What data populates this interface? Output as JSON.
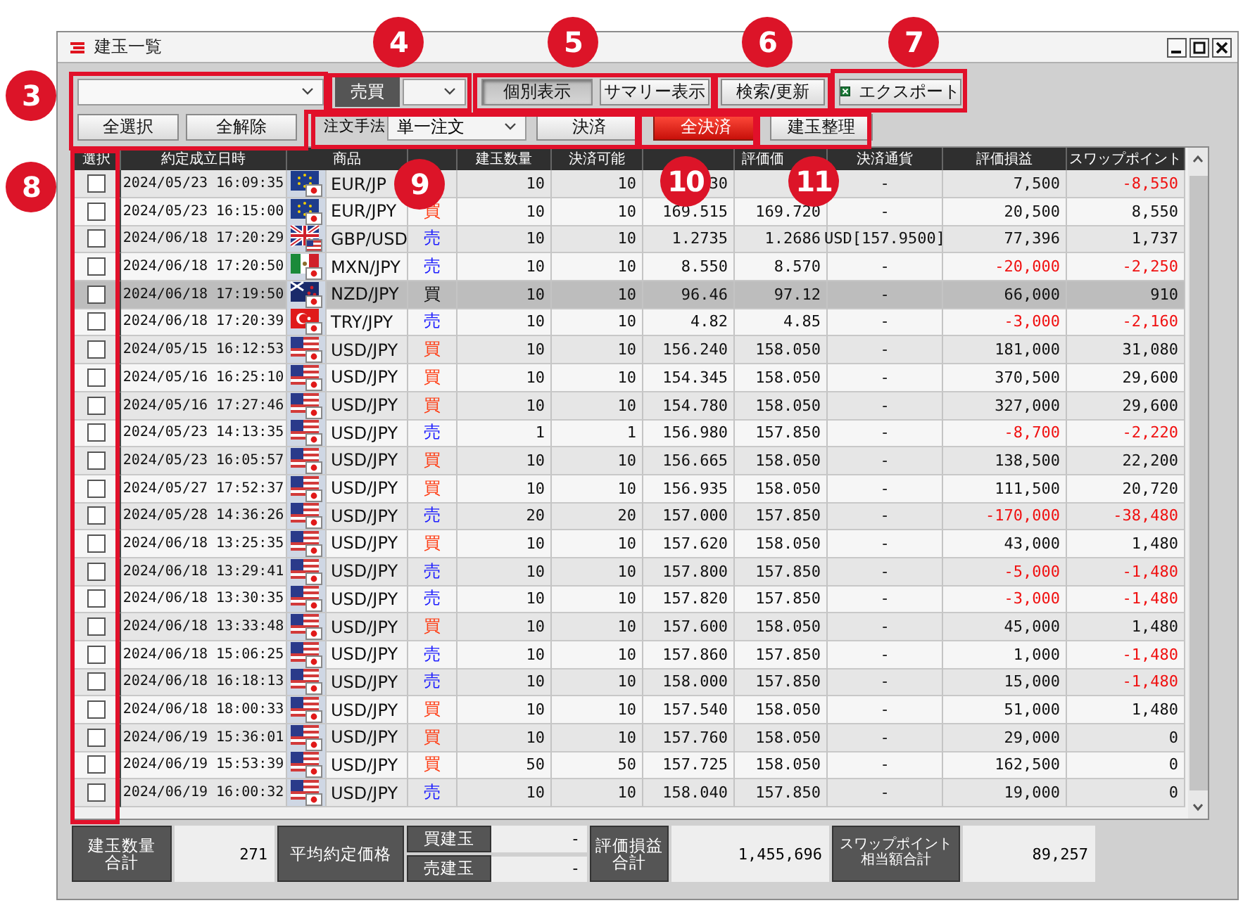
{
  "window": {
    "title": "建玉一覧"
  },
  "toolbar": {
    "side_label": "売買",
    "view_buttons": [
      {
        "label": "個別表示",
        "selected": true
      },
      {
        "label": "サマリー表示",
        "selected": false
      }
    ],
    "search_button": "検索/更新",
    "export_button": "エクスポート",
    "select_all_button": "全選択",
    "deselect_all_button": "全解除",
    "order_method_label": "注文手法",
    "order_method": "単一注文",
    "settle_button": "決済",
    "settle_all_button": "全決済",
    "organize_button": "建玉整理"
  },
  "table": {
    "columns": [
      "選択",
      "約定成立日時",
      "商品",
      null,
      "建玉数量",
      "決済可能",
      null,
      "評価価",
      "決済通貨",
      "評価損益",
      "スワップポイント"
    ],
    "rows": [
      {
        "checked": false,
        "selected": false,
        "datetime": "2024/05/23 16:09:35",
        "flag": {
          "kind": "eu"
        },
        "quote_flag": {
          "kind": "jp"
        },
        "pair": "EUR/JP",
        "qty": "10",
        "settleable": "10",
        "price": "30",
        "currency": "-",
        "pl": {
          "text": "7,500",
          "color": "#111111"
        },
        "swap": {
          "text": "-8,550",
          "color": "#f01010"
        }
      },
      {
        "checked": false,
        "selected": false,
        "datetime": "2024/05/23 16:15:00",
        "flag": {
          "kind": "eu"
        },
        "quote_flag": {
          "kind": "jp"
        },
        "pair": "EUR/JPY",
        "side": {
          "text": "買",
          "color": "#ff3a10"
        },
        "qty": "10",
        "settleable": "10",
        "price": "169.515",
        "eval_price": "169.720",
        "currency": "-",
        "pl": {
          "text": "20,500",
          "color": "#111111"
        },
        "swap": {
          "text": "8,550",
          "color": "#111111"
        }
      },
      {
        "checked": false,
        "selected": false,
        "datetime": "2024/06/18 17:20:29",
        "flag": {
          "kind": "gb"
        },
        "quote_flag": {
          "kind": "us"
        },
        "pair": "GBP/USD",
        "side": {
          "text": "売",
          "color": "#1a1aff"
        },
        "qty": "10",
        "settleable": "10",
        "price": "1.2735",
        "eval_price": "1.2686",
        "currency": "USD[157.9500]",
        "pl": {
          "text": "77,396",
          "color": "#111111"
        },
        "swap": {
          "text": "1,737",
          "color": "#111111"
        }
      },
      {
        "checked": false,
        "selected": false,
        "datetime": "2024/06/18 17:20:50",
        "flag": {
          "kind": "mx"
        },
        "quote_flag": {
          "kind": "jp"
        },
        "pair": "MXN/JPY",
        "side": {
          "text": "売",
          "color": "#1a1aff"
        },
        "qty": "10",
        "settleable": "10",
        "price": "8.550",
        "eval_price": "8.570",
        "currency": "-",
        "pl": {
          "text": "-20,000",
          "color": "#f01010"
        },
        "swap": {
          "text": "-2,250",
          "color": "#f01010"
        }
      },
      {
        "checked": false,
        "selected": true,
        "datetime": "2024/06/18 17:19:50",
        "flag": {
          "kind": "nz"
        },
        "quote_flag": {
          "kind": "jp"
        },
        "pair": "NZD/JPY",
        "side": {
          "text": "買",
          "color": "#111111"
        },
        "qty": "10",
        "settleable": "10",
        "price": "96.46",
        "eval_price": "97.12",
        "currency": "-",
        "pl": {
          "text": "66,000",
          "color": "#111111"
        },
        "swap": {
          "text": "910",
          "color": "#111111"
        }
      },
      {
        "checked": false,
        "selected": false,
        "datetime": "2024/06/18 17:20:39",
        "flag": {
          "kind": "tr"
        },
        "quote_flag": {
          "kind": "jp"
        },
        "pair": "TRY/JPY",
        "side": {
          "text": "売",
          "color": "#1a1aff"
        },
        "qty": "10",
        "settleable": "10",
        "price": "4.82",
        "eval_price": "4.85",
        "currency": "-",
        "pl": {
          "text": "-3,000",
          "color": "#f01010"
        },
        "swap": {
          "text": "-2,160",
          "color": "#f01010"
        }
      },
      {
        "checked": false,
        "selected": false,
        "datetime": "2024/05/15 16:12:53",
        "flag": {
          "kind": "us"
        },
        "quote_flag": {
          "kind": "jp"
        },
        "pair": "USD/JPY",
        "side": {
          "text": "買",
          "color": "#ff3a10"
        },
        "qty": "10",
        "settleable": "10",
        "price": "156.240",
        "eval_price": "158.050",
        "currency": "-",
        "pl": {
          "text": "181,000",
          "color": "#111111"
        },
        "swap": {
          "text": "31,080",
          "color": "#111111"
        }
      },
      {
        "checked": false,
        "selected": false,
        "datetime": "2024/05/16 16:25:10",
        "flag": {
          "kind": "us"
        },
        "quote_flag": {
          "kind": "jp"
        },
        "pair": "USD/JPY",
        "side": {
          "text": "買",
          "color": "#ff3a10"
        },
        "qty": "10",
        "settleable": "10",
        "price": "154.345",
        "eval_price": "158.050",
        "currency": "-",
        "pl": {
          "text": "370,500",
          "color": "#111111"
        },
        "swap": {
          "text": "29,600",
          "color": "#111111"
        }
      },
      {
        "checked": false,
        "selected": false,
        "datetime": "2024/05/16 17:27:46",
        "flag": {
          "kind": "us"
        },
        "quote_flag": {
          "kind": "jp"
        },
        "pair": "USD/JPY",
        "side": {
          "text": "買",
          "color": "#ff3a10"
        },
        "qty": "10",
        "settleable": "10",
        "price": "154.780",
        "eval_price": "158.050",
        "currency": "-",
        "pl": {
          "text": "327,000",
          "color": "#111111"
        },
        "swap": {
          "text": "29,600",
          "color": "#111111"
        }
      },
      {
        "checked": false,
        "selected": false,
        "datetime": "2024/05/23 14:13:35",
        "flag": {
          "kind": "us"
        },
        "quote_flag": {
          "kind": "jp"
        },
        "pair": "USD/JPY",
        "side": {
          "text": "売",
          "color": "#1a1aff"
        },
        "qty": "1",
        "settleable": "1",
        "price": "156.980",
        "eval_price": "157.850",
        "currency": "-",
        "pl": {
          "text": "-8,700",
          "color": "#f01010"
        },
        "swap": {
          "text": "-2,220",
          "color": "#f01010"
        }
      },
      {
        "checked": false,
        "selected": false,
        "datetime": "2024/05/23 16:05:57",
        "flag": {
          "kind": "us"
        },
        "quote_flag": {
          "kind": "jp"
        },
        "pair": "USD/JPY",
        "side": {
          "text": "買",
          "color": "#ff3a10"
        },
        "qty": "10",
        "settleable": "10",
        "price": "156.665",
        "eval_price": "158.050",
        "currency": "-",
        "pl": {
          "text": "138,500",
          "color": "#111111"
        },
        "swap": {
          "text": "22,200",
          "color": "#111111"
        }
      },
      {
        "checked": false,
        "selected": false,
        "datetime": "2024/05/27 17:52:37",
        "flag": {
          "kind": "us"
        },
        "quote_flag": {
          "kind": "jp"
        },
        "pair": "USD/JPY",
        "side": {
          "text": "買",
          "color": "#ff3a10"
        },
        "qty": "10",
        "settleable": "10",
        "price": "156.935",
        "eval_price": "158.050",
        "currency": "-",
        "pl": {
          "text": "111,500",
          "color": "#111111"
        },
        "swap": {
          "text": "20,720",
          "color": "#111111"
        }
      },
      {
        "checked": false,
        "selected": false,
        "datetime": "2024/05/28 14:36:26",
        "flag": {
          "kind": "us"
        },
        "quote_flag": {
          "kind": "jp"
        },
        "pair": "USD/JPY",
        "side": {
          "text": "売",
          "color": "#1a1aff"
        },
        "qty": "20",
        "settleable": "20",
        "price": "157.000",
        "eval_price": "157.850",
        "currency": "-",
        "pl": {
          "text": "-170,000",
          "color": "#f01010"
        },
        "swap": {
          "text": "-38,480",
          "color": "#f01010"
        }
      },
      {
        "checked": false,
        "selected": false,
        "datetime": "2024/06/18 13:25:35",
        "flag": {
          "kind": "us"
        },
        "quote_flag": {
          "kind": "jp"
        },
        "pair": "USD/JPY",
        "side": {
          "text": "買",
          "color": "#ff3a10"
        },
        "qty": "10",
        "settleable": "10",
        "price": "157.620",
        "eval_price": "158.050",
        "currency": "-",
        "pl": {
          "text": "43,000",
          "color": "#111111"
        },
        "swap": {
          "text": "1,480",
          "color": "#111111"
        }
      },
      {
        "checked": false,
        "selected": false,
        "datetime": "2024/06/18 13:29:41",
        "flag": {
          "kind": "us"
        },
        "quote_flag": {
          "kind": "jp"
        },
        "pair": "USD/JPY",
        "side": {
          "text": "売",
          "color": "#1a1aff"
        },
        "qty": "10",
        "settleable": "10",
        "price": "157.800",
        "eval_price": "157.850",
        "currency": "-",
        "pl": {
          "text": "-5,000",
          "color": "#f01010"
        },
        "swap": {
          "text": "-1,480",
          "color": "#f01010"
        }
      },
      {
        "checked": false,
        "selected": false,
        "datetime": "2024/06/18 13:30:35",
        "flag": {
          "kind": "us"
        },
        "quote_flag": {
          "kind": "jp"
        },
        "pair": "USD/JPY",
        "side": {
          "text": "売",
          "color": "#1a1aff"
        },
        "qty": "10",
        "settleable": "10",
        "price": "157.820",
        "eval_price": "157.850",
        "currency": "-",
        "pl": {
          "text": "-3,000",
          "color": "#f01010"
        },
        "swap": {
          "text": "-1,480",
          "color": "#f01010"
        }
      },
      {
        "checked": false,
        "selected": false,
        "datetime": "2024/06/18 13:33:48",
        "flag": {
          "kind": "us"
        },
        "quote_flag": {
          "kind": "jp"
        },
        "pair": "USD/JPY",
        "side": {
          "text": "買",
          "color": "#ff3a10"
        },
        "qty": "10",
        "settleable": "10",
        "price": "157.600",
        "eval_price": "158.050",
        "currency": "-",
        "pl": {
          "text": "45,000",
          "color": "#111111"
        },
        "swap": {
          "text": "1,480",
          "color": "#111111"
        }
      },
      {
        "checked": false,
        "selected": false,
        "datetime": "2024/06/18 15:06:25",
        "flag": {
          "kind": "us"
        },
        "quote_flag": {
          "kind": "jp"
        },
        "pair": "USD/JPY",
        "side": {
          "text": "売",
          "color": "#1a1aff"
        },
        "qty": "10",
        "settleable": "10",
        "price": "157.860",
        "eval_price": "157.850",
        "currency": "-",
        "pl": {
          "text": "1,000",
          "color": "#111111"
        },
        "swap": {
          "text": "-1,480",
          "color": "#f01010"
        }
      },
      {
        "checked": false,
        "selected": false,
        "datetime": "2024/06/18 16:18:13",
        "flag": {
          "kind": "us"
        },
        "quote_flag": {
          "kind": "jp"
        },
        "pair": "USD/JPY",
        "side": {
          "text": "売",
          "color": "#1a1aff"
        },
        "qty": "10",
        "settleable": "10",
        "price": "158.000",
        "eval_price": "157.850",
        "currency": "-",
        "pl": {
          "text": "15,000",
          "color": "#111111"
        },
        "swap": {
          "text": "-1,480",
          "color": "#f01010"
        }
      },
      {
        "checked": false,
        "selected": false,
        "datetime": "2024/06/18 18:00:33",
        "flag": {
          "kind": "us"
        },
        "quote_flag": {
          "kind": "jp"
        },
        "pair": "USD/JPY",
        "side": {
          "text": "買",
          "color": "#ff3a10"
        },
        "qty": "10",
        "settleable": "10",
        "price": "157.540",
        "eval_price": "158.050",
        "currency": "-",
        "pl": {
          "text": "51,000",
          "color": "#111111"
        },
        "swap": {
          "text": "1,480",
          "color": "#111111"
        }
      },
      {
        "checked": false,
        "selected": false,
        "datetime": "2024/06/19 15:36:01",
        "flag": {
          "kind": "us"
        },
        "quote_flag": {
          "kind": "jp"
        },
        "pair": "USD/JPY",
        "side": {
          "text": "買",
          "color": "#ff3a10"
        },
        "qty": "10",
        "settleable": "10",
        "price": "157.760",
        "eval_price": "158.050",
        "currency": "-",
        "pl": {
          "text": "29,000",
          "color": "#111111"
        },
        "swap": {
          "text": "0",
          "color": "#111111"
        }
      },
      {
        "checked": false,
        "selected": false,
        "datetime": "2024/06/19 15:53:39",
        "flag": {
          "kind": "us"
        },
        "quote_flag": {
          "kind": "jp"
        },
        "pair": "USD/JPY",
        "side": {
          "text": "買",
          "color": "#ff3a10"
        },
        "qty": "50",
        "settleable": "50",
        "price": "157.725",
        "eval_price": "158.050",
        "currency": "-",
        "pl": {
          "text": "162,500",
          "color": "#111111"
        },
        "swap": {
          "text": "0",
          "color": "#111111"
        }
      },
      {
        "checked": false,
        "selected": false,
        "datetime": "2024/06/19 16:00:32",
        "flag": {
          "kind": "us"
        },
        "quote_flag": {
          "kind": "jp"
        },
        "pair": "USD/JPY",
        "side": {
          "text": "売",
          "color": "#1a1aff"
        },
        "qty": "10",
        "settleable": "10",
        "price": "158.040",
        "eval_price": "157.850",
        "currency": "-",
        "pl": {
          "text": "19,000",
          "color": "#111111"
        },
        "swap": {
          "text": "0",
          "color": "#111111"
        }
      }
    ]
  },
  "summary": {
    "qty_label": "建玉数量合計",
    "qty_total": "271",
    "avg_price_label": "平均約定価格",
    "buy_label": "買建玉",
    "buy_avg": "-",
    "sell_label": "売建玉",
    "sell_avg": "-",
    "pl_label": "評価損益合計",
    "pl_total": "1,455,696",
    "swap_label": "スワップポイント相当額合計",
    "swap_total": "89,257"
  },
  "callouts": [
    "3",
    "4",
    "5",
    "6",
    "7",
    "8",
    "9",
    "10",
    "11"
  ]
}
